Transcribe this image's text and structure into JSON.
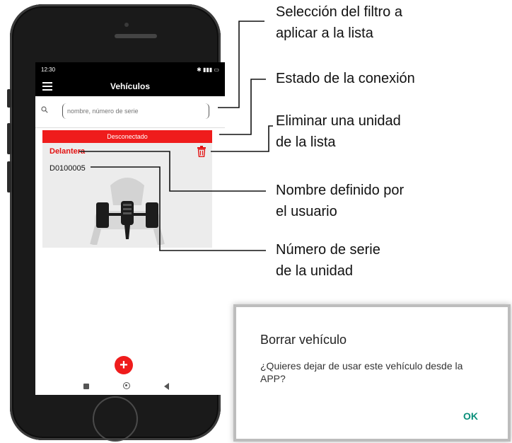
{
  "status_bar": {
    "time": "12:30",
    "right": "4G"
  },
  "app": {
    "title": "Vehículos"
  },
  "search": {
    "placeholder": "nombre, número de serie"
  },
  "unit": {
    "connection_status": "Desconectado",
    "name": "Delantera",
    "serial": "D0100005"
  },
  "fab": {
    "label": "+"
  },
  "annotations": {
    "filter": [
      "Selección del filtro a",
      "aplicar a la lista"
    ],
    "connection": [
      "Estado de la conexión"
    ],
    "delete": [
      "Eliminar una unidad",
      "de la lista"
    ],
    "user_name": [
      "Nombre definido por",
      "el usuario"
    ],
    "serial": [
      "Número de serie",
      "de la unidad"
    ]
  },
  "dialog": {
    "title": "Borrar vehículo",
    "message": "¿Quieres dejar de usar este vehículo desde la APP?",
    "ok": "OK"
  },
  "colors": {
    "accent_red": "#ef1c1c",
    "dialog_button": "#0a8f7a"
  },
  "icons": [
    "hamburger-icon",
    "search-icon",
    "trash-icon",
    "axle-icon",
    "plus-icon"
  ]
}
